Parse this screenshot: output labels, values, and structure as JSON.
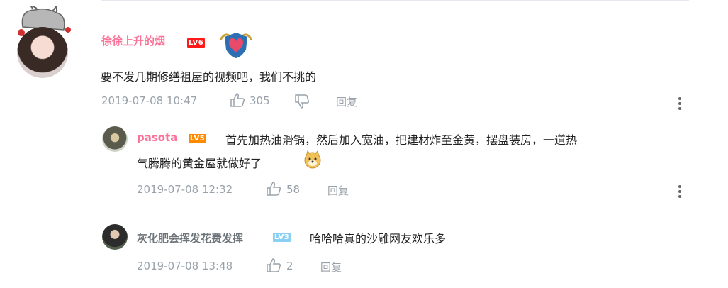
{
  "comment": {
    "user": "徐徐上升的烟",
    "level": "LV6",
    "text": "要不发几期修缮祖屋的视频吧，我们不挑的",
    "time": "2019-07-08 10:47",
    "likes": "305",
    "reply_label": "回复"
  },
  "replies": [
    {
      "user": "pasota",
      "level": "LV5",
      "text_line1": "首先加热油滑锅，然后加入宽油，把建材炸至金黄，摆盘装房，一道热",
      "text_line2": "气腾腾的黄金屋就做好了",
      "emoji": "doge-emoji",
      "time": "2019-07-08 12:32",
      "likes": "58",
      "reply_label": "回复"
    },
    {
      "user": "灰化肥会挥发花费发挥",
      "level": "LV3",
      "text": "哈哈哈真的沙雕网友欢乐多",
      "time": "2019-07-08 13:48",
      "likes": "2",
      "reply_label": "回复"
    }
  ],
  "colors": {
    "username": "#fb7299",
    "meta": "#99a2aa",
    "lv6": "#ff1a1a",
    "lv5": "#ff8a00",
    "lv3": "#8ad0f4"
  }
}
